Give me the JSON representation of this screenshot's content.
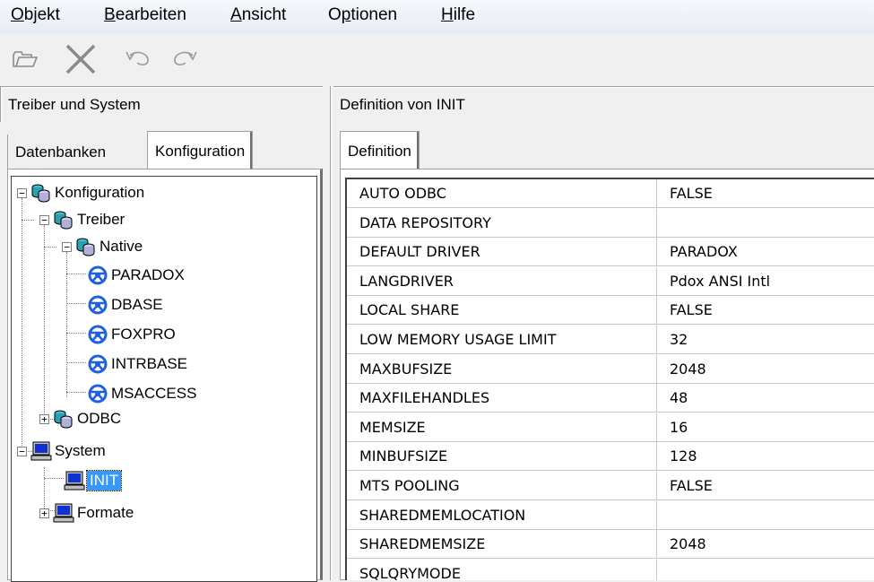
{
  "menu": [
    {
      "label": "Objekt"
    },
    {
      "label": "Bearbeiten"
    },
    {
      "label": "Ansicht"
    },
    {
      "label": "Optionen"
    },
    {
      "label": "Hilfe"
    }
  ],
  "toolbar": {
    "icons": [
      "open-folder-icon",
      "delete-x-icon",
      "undo-icon",
      "redo-icon"
    ]
  },
  "left_header": "Treiber und System",
  "right_header": "Definition von INIT",
  "left_tabs": [
    "Datenbanken",
    "Konfiguration"
  ],
  "right_tabs": [
    "Definition"
  ],
  "tree": {
    "root": "Konfiguration",
    "treiber": "Treiber",
    "native": "Native",
    "drivers": [
      "PARADOX",
      "DBASE",
      "FOXPRO",
      "INTRBASE",
      "MSACCESS"
    ],
    "odbc": "ODBC",
    "system": "System",
    "init": "INIT",
    "formate": "Formate"
  },
  "definition": [
    {
      "key": "AUTO ODBC",
      "value": "FALSE"
    },
    {
      "key": "DATA REPOSITORY",
      "value": ""
    },
    {
      "key": "DEFAULT DRIVER",
      "value": "PARADOX"
    },
    {
      "key": "LANGDRIVER",
      "value": "Pdox ANSI Intl"
    },
    {
      "key": "LOCAL SHARE",
      "value": "FALSE"
    },
    {
      "key": "LOW MEMORY USAGE LIMIT",
      "value": "32"
    },
    {
      "key": "MAXBUFSIZE",
      "value": "2048"
    },
    {
      "key": "MAXFILEHANDLES",
      "value": "48"
    },
    {
      "key": "MEMSIZE",
      "value": "16"
    },
    {
      "key": "MINBUFSIZE",
      "value": "128"
    },
    {
      "key": "MTS POOLING",
      "value": "FALSE"
    },
    {
      "key": "SHAREDMEMLOCATION",
      "value": ""
    },
    {
      "key": "SHAREDMEMSIZE",
      "value": "2048"
    },
    {
      "key": "SQLQRYMODE",
      "value": ""
    }
  ]
}
